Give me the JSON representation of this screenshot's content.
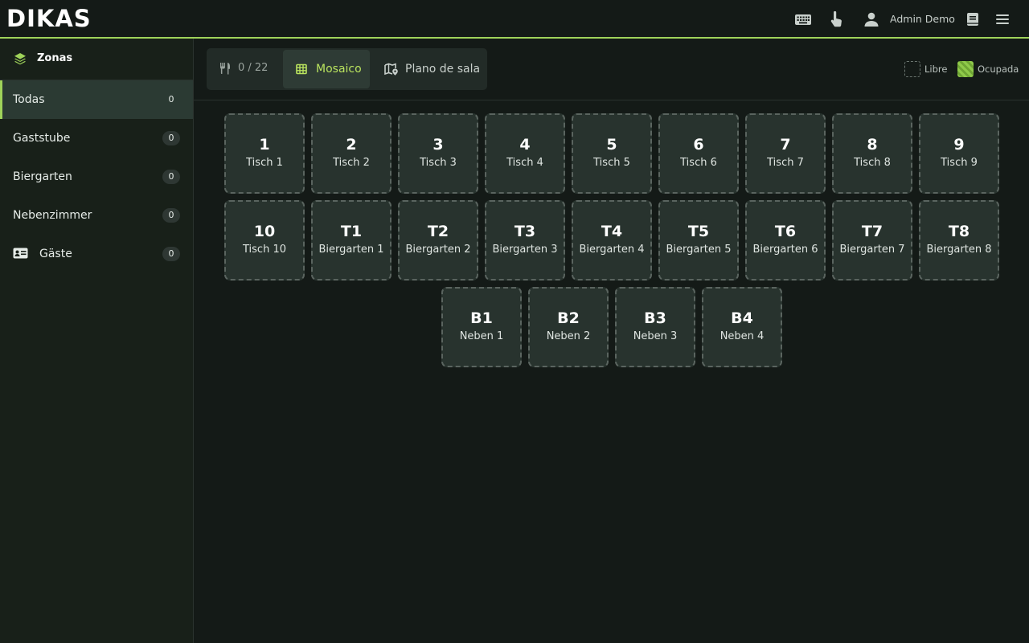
{
  "app": {
    "logo_text": "DIKAS"
  },
  "topbar": {
    "user_label": "Admin Demo",
    "icons": [
      "keyboard-icon",
      "touch-icon",
      "user-icon",
      "book-icon",
      "menu-icon"
    ]
  },
  "sidebar": {
    "header": "Zonas",
    "items": [
      {
        "label": "Todas",
        "count": "0",
        "active": true
      },
      {
        "label": "Gaststube",
        "count": "0"
      },
      {
        "label": "Biergarten",
        "count": "0"
      },
      {
        "label": "Nebenzimmer",
        "count": "0"
      },
      {
        "label": "Gäste",
        "count": "0",
        "icon": "guest-card-icon"
      }
    ]
  },
  "toolbar": {
    "table_count": "0 / 22",
    "mosaic_label": "Mosaico",
    "floorplan_label": "Plano de sala"
  },
  "legend": {
    "free_label": "Libre",
    "occupied_label": "Ocupada",
    "occupied_color": "#8fc94a"
  },
  "colors": {
    "accent": "#9fd35a",
    "accent_text": "#b9e35e"
  },
  "tables": [
    {
      "num": "1",
      "name": "Tisch 1"
    },
    {
      "num": "2",
      "name": "Tisch 2"
    },
    {
      "num": "3",
      "name": "Tisch 3"
    },
    {
      "num": "4",
      "name": "Tisch 4"
    },
    {
      "num": "5",
      "name": "Tisch 5"
    },
    {
      "num": "6",
      "name": "Tisch 6"
    },
    {
      "num": "7",
      "name": "Tisch 7"
    },
    {
      "num": "8",
      "name": "Tisch 8"
    },
    {
      "num": "9",
      "name": "Tisch 9"
    },
    {
      "num": "10",
      "name": "Tisch 10"
    },
    {
      "num": "T1",
      "name": "Biergarten 1"
    },
    {
      "num": "T2",
      "name": "Biergarten 2"
    },
    {
      "num": "T3",
      "name": "Biergarten 3"
    },
    {
      "num": "T4",
      "name": "Biergarten 4"
    },
    {
      "num": "T5",
      "name": "Biergarten 5"
    },
    {
      "num": "T6",
      "name": "Biergarten 6"
    },
    {
      "num": "T7",
      "name": "Biergarten 7"
    },
    {
      "num": "T8",
      "name": "Biergarten 8"
    },
    {
      "num": "B1",
      "name": "Neben 1"
    },
    {
      "num": "B2",
      "name": "Neben 2"
    },
    {
      "num": "B3",
      "name": "Neben 3"
    },
    {
      "num": "B4",
      "name": "Neben 4"
    }
  ]
}
